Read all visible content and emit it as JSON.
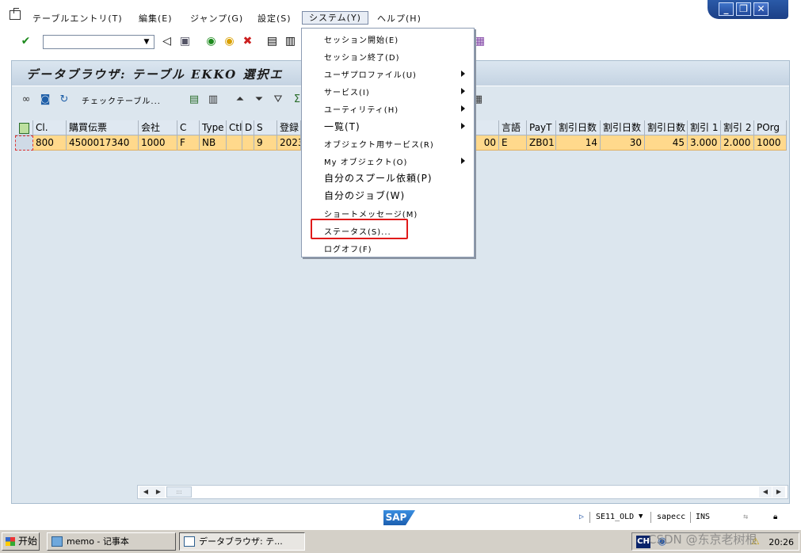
{
  "menubar": {
    "items": [
      {
        "label": "テーブルエントリ(T)"
      },
      {
        "label": "編集(E)"
      },
      {
        "label": "ジャンプ(G)"
      },
      {
        "label": "設定(S)"
      },
      {
        "label": "システム(Y)"
      },
      {
        "label": "ヘルプ(H)"
      }
    ]
  },
  "window_controls": {
    "minimize": "_",
    "restore": "❐",
    "close": "✕"
  },
  "page": {
    "title": "データブラウザ: テーブル EKKO 選択エ",
    "check_table_label": "チェックテーブル..."
  },
  "grid": {
    "columns": [
      "Cl.",
      "購買伝票",
      "会社",
      "C",
      "Type",
      "Ctl",
      "D",
      "S",
      "登録日",
      "",
      "言語",
      "PayT",
      "割引日数",
      "割引日数",
      "割引日数",
      "割引 1",
      "割引 2",
      "POrg"
    ],
    "row": [
      "800",
      "4500017340",
      "1000",
      "F",
      "NB",
      "",
      "",
      "9",
      "2023",
      "00",
      "E",
      "ZB01",
      "14",
      "30",
      "45",
      "3.000",
      "2.000",
      "1000"
    ]
  },
  "dropdown": {
    "items": [
      {
        "label": "セッション開始(E)"
      },
      {
        "label": "セッション終了(D)"
      },
      {
        "label": "ユーザプロファイル(U)",
        "submenu": true
      },
      {
        "label": "サービス(I)",
        "submenu": true
      },
      {
        "label": "ユーティリティ(H)",
        "submenu": true
      },
      {
        "label": "一覧(T)",
        "submenu": true
      },
      {
        "label": "オブジェクト用サービス(R)"
      },
      {
        "label": "My オブジェクト(O)",
        "submenu": true
      },
      {
        "label": "自分のスプール依頼(P)"
      },
      {
        "label": "自分のジョブ(W)"
      },
      {
        "label": "ショートメッセージ(M)"
      },
      {
        "label": "ステータス(S)..."
      },
      {
        "label": "ログオフ(F)"
      }
    ],
    "highlight_color": "#e01a1a"
  },
  "statusbar": {
    "logo": "SAP",
    "transaction": "SE11_OLD",
    "server": "sapecc",
    "mode": "INS"
  },
  "taskbar": {
    "start": "开始",
    "tasks": [
      {
        "label": "memo - 记事本"
      },
      {
        "label": "データブラウザ: テ..."
      }
    ],
    "lang": "CH",
    "clock": "20:26"
  },
  "watermark": "CSDN @东京老树根",
  "colors": {
    "selected_row": "#ffd98c",
    "content_bg": "#dce6ee",
    "sap_blue": "#1c5fb0"
  }
}
